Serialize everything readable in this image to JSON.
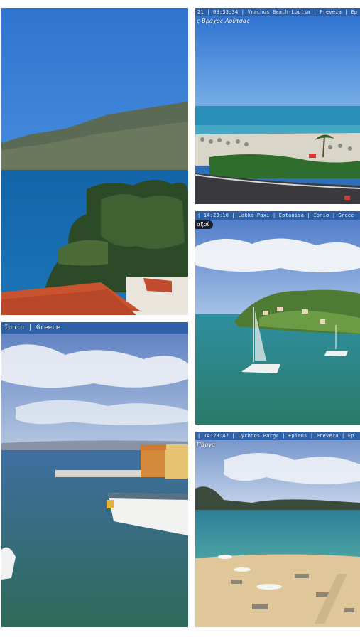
{
  "gallery": {
    "tiles": [
      {
        "id": "tile-1",
        "overlay": ""
      },
      {
        "id": "tile-2",
        "overlay": "21  |  09:33:34  |  Vrachos Beach-Loutsa  |  Preveza  |  Ep",
        "caption": "ς Βράχος Λούτσας"
      },
      {
        "id": "tile-3",
        "overlay": "|  14:23:10  |  Lakka Paxi  |  Eptanisa  |  Ionio  |  Greec",
        "caption": "αξοί"
      },
      {
        "id": "tile-4",
        "overlay": "Ionio   |   Greece"
      },
      {
        "id": "tile-5",
        "overlay": "|  14:23:47  |  Lychnos Parga  |  Epirus  |  Preveza  |  Ep",
        "caption": "Πάργα"
      }
    ]
  },
  "colors": {
    "overlay_bar": "#2b5fa5",
    "sea": "#1d6fb0",
    "sky": "#3a86d6"
  }
}
